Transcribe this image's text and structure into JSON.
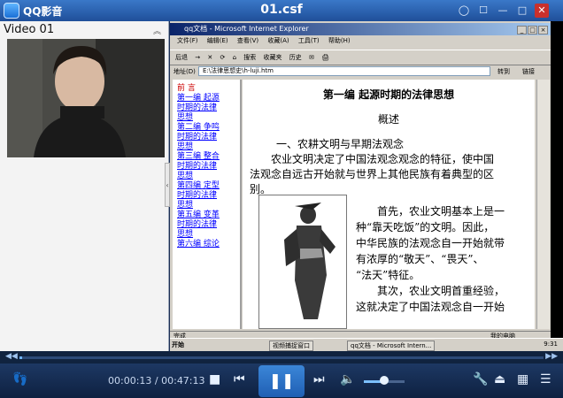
{
  "window": {
    "app_name": "QQ影音",
    "file_title": "01.csf",
    "buttons": {
      "skin": "◯",
      "settings": "☐",
      "minimize": "—",
      "maximize": "□",
      "close": "✕"
    }
  },
  "playlist": {
    "title": "Video 01",
    "collapse": "︽"
  },
  "ie": {
    "title": "qq文档 - Microsoft Internet Explorer",
    "menu": [
      "文件(F)",
      "编辑(E)",
      "查看(V)",
      "收藏(A)",
      "工具(T)",
      "帮助(H)"
    ],
    "toolbar": [
      "后退",
      "→",
      "✕",
      "⟳",
      "⌂",
      "搜索",
      "收藏夹",
      "历史",
      "✉",
      "🖨"
    ],
    "address_label": "地址(D)",
    "address_value": "E:\\法律思想史\\h-luji.htm",
    "go_label": "转到",
    "links_label": "链接",
    "status_left": "完成",
    "status_right": "我的电脑"
  },
  "toc": {
    "head": "前 言",
    "items": [
      "第一编 起源",
      "时期的法律",
      "思想",
      "第二编 争鸣",
      "时期的法律",
      "思想",
      "第三编 整合",
      "时期的法律",
      "思想",
      "第四编 定型",
      "时期的法律",
      "思想",
      "第五编 变革",
      "时期的法律",
      "思想",
      "第六编 综论"
    ]
  },
  "doc": {
    "title": "第一编  起源时期的法律思想",
    "subtitle": "概述",
    "lines": [
      "一、农耕文明与早期法观念",
      "农业文明决定了中国法观念观念的特征，使中国",
      "法观念自远古开始就与世界上其他民族有着典型的区",
      "别。",
      "首先，农业文明基本上是一",
      "种“靠天吃饭”的文明。因此，",
      "中华民族的法观念自一开始就带",
      "有浓厚的“敬天”、“畏天”、",
      "“法天”特征。",
      "其次，农业文明首重经验，",
      "这就决定了中国法观念自一开始"
    ]
  },
  "taskbar": {
    "start": "开始",
    "tasks": [
      "视频捕捉窗口",
      "qq文档 - Microsoft Intern..."
    ],
    "clock": "9:31"
  },
  "player": {
    "current_time": "00:00:13",
    "separator": " / ",
    "total_time": "00:47:13",
    "progress": 0.005,
    "volume": 0.5,
    "buttons": {
      "footprint": "👣",
      "stop": "■",
      "prev": "⏮",
      "play_pause": "❚❚",
      "next": "⏭",
      "volume": "🔈",
      "tools": "🔧",
      "eject": "⏏",
      "skin": "▦",
      "menu": "☰"
    },
    "seek_left": "◀◀",
    "seek_right": "▶▶"
  }
}
